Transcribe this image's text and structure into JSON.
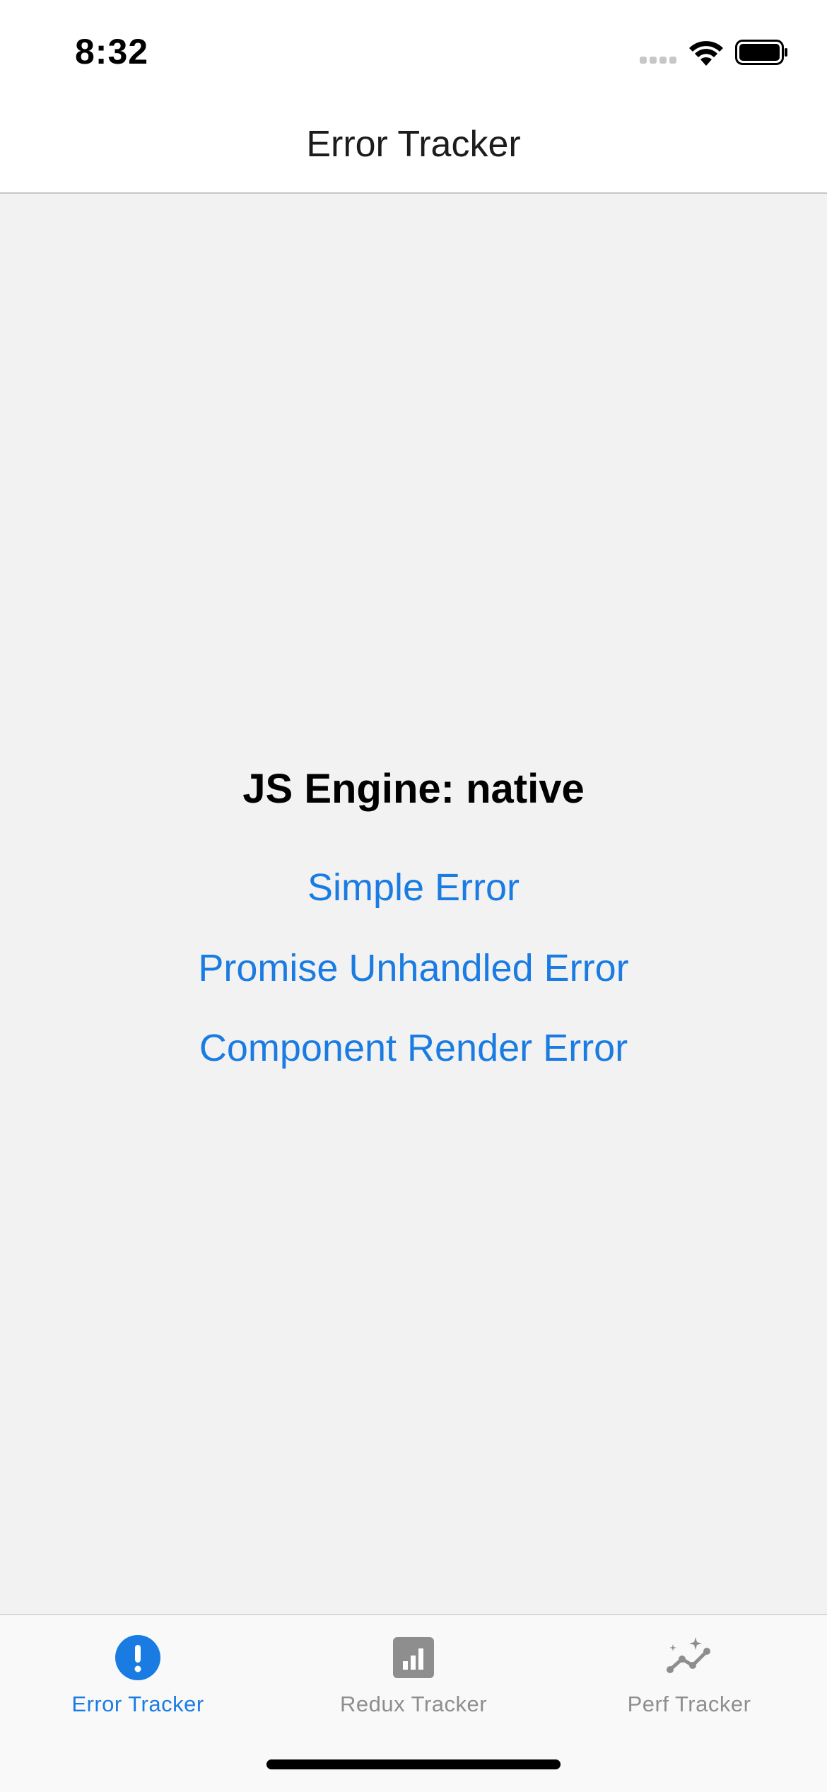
{
  "status_bar": {
    "time": "8:32"
  },
  "nav": {
    "title": "Error Tracker"
  },
  "main": {
    "engine_label": "JS Engine: native",
    "actions": [
      {
        "label": "Simple Error"
      },
      {
        "label": "Promise Unhandled Error"
      },
      {
        "label": "Component Render Error"
      }
    ]
  },
  "tabs": [
    {
      "label": "Error Tracker",
      "icon": "exclamation-circle-icon",
      "active": true
    },
    {
      "label": "Redux Tracker",
      "icon": "bar-chart-icon",
      "active": false
    },
    {
      "label": "Perf Tracker",
      "icon": "trend-sparkle-icon",
      "active": false
    }
  ],
  "colors": {
    "accent": "#1a7ce3",
    "inactive": "#8e8e8e",
    "background": "#f2f2f2"
  }
}
